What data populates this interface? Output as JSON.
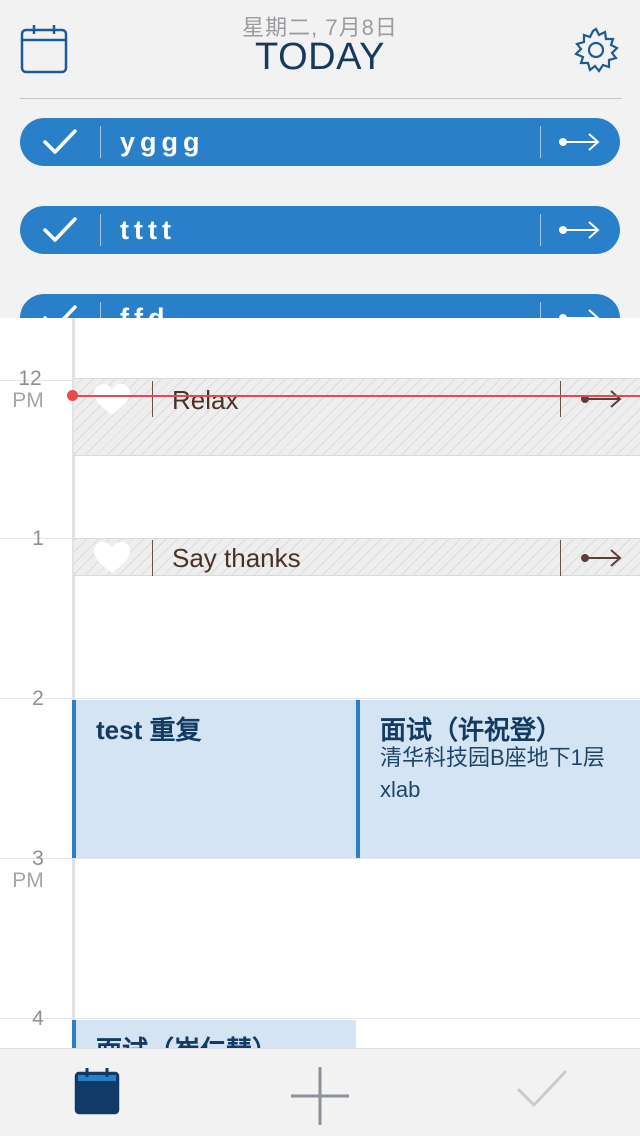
{
  "header": {
    "date": "星期二, 7月8日",
    "title": "TODAY",
    "calendar_icon": "calendar-icon",
    "settings_icon": "gear-icon"
  },
  "tasks": [
    {
      "label": "yggg",
      "check_icon": "checkmark-icon",
      "defer_icon": "arrow-right-icon"
    },
    {
      "label": "tttt",
      "check_icon": "checkmark-icon",
      "defer_icon": "arrow-right-icon"
    },
    {
      "label": "ffd",
      "check_icon": "checkmark-icon",
      "defer_icon": "arrow-right-icon"
    }
  ],
  "calendar": {
    "hours": [
      {
        "hour": "12",
        "period": "PM"
      },
      {
        "hour": "1",
        "period": ""
      },
      {
        "hour": "2",
        "period": ""
      },
      {
        "hour": "3",
        "period": "PM"
      },
      {
        "hour": "4",
        "period": ""
      }
    ],
    "habit_events": [
      {
        "label": "Relax",
        "icon": "heart-icon",
        "defer_icon": "arrow-right-icon"
      },
      {
        "label": "Say thanks",
        "icon": "heart-icon",
        "defer_icon": "arrow-right-icon"
      }
    ],
    "events": [
      {
        "title": "test 重复",
        "subtitle": []
      },
      {
        "title": "面试（许祝登）",
        "subtitle": [
          "清华科技园B座地下1层",
          "xlab"
        ]
      },
      {
        "title": "面试（崔仁彗）",
        "subtitle": []
      }
    ],
    "now_indicator_color": "#e84a4a"
  },
  "tabbar": {
    "items": [
      {
        "name": "calendar",
        "icon": "calendar-filled-icon",
        "active": true
      },
      {
        "name": "add",
        "icon": "plus-icon",
        "active": false
      },
      {
        "name": "done",
        "icon": "checkmark-icon",
        "active": false
      }
    ]
  },
  "colors": {
    "accent": "#2a80c8",
    "title": "#163a5f",
    "event_bg": "#d4e4f3",
    "background": "#f2f2f3"
  }
}
